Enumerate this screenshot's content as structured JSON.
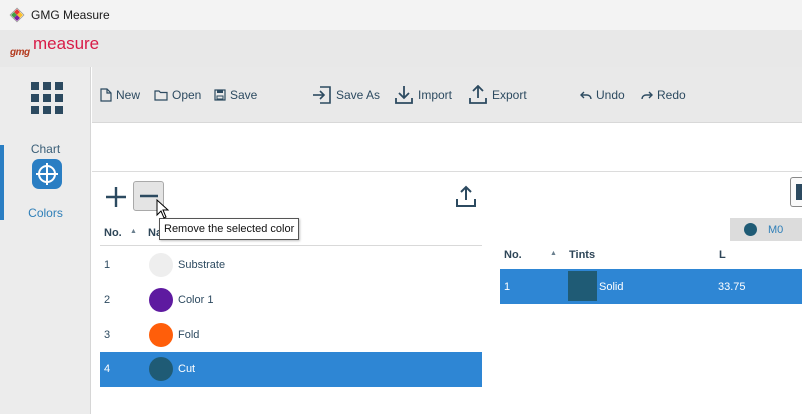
{
  "window": {
    "title": "GMG Measure",
    "icon": "gmg-app-icon"
  },
  "brand": {
    "gmg": "gmg",
    "measure": "measure",
    "color": "#d81b47"
  },
  "nav": [
    {
      "label": "Chart",
      "icon": "grid-icon",
      "selected": false
    },
    {
      "label": "Colors",
      "icon": "color-target-icon",
      "selected": true
    }
  ],
  "toolbar": {
    "new": "New",
    "open": "Open",
    "save": "Save",
    "save_as": "Save As",
    "import": "Import",
    "export": "Export",
    "undo": "Undo",
    "redo": "Redo"
  },
  "colors_list": {
    "headers": {
      "no": "No.",
      "name": "Na"
    },
    "tooltip": "Remove the selected color",
    "rows": [
      {
        "no": "1",
        "name": "Substrate",
        "color": "#eeeeee",
        "selected": false
      },
      {
        "no": "2",
        "name": "Color 1",
        "color": "#5e1aa0",
        "selected": false
      },
      {
        "no": "3",
        "name": "Fold",
        "color": "#ff5e0a",
        "selected": false
      },
      {
        "no": "4",
        "name": "Cut",
        "color": "#1f5b75",
        "selected": true
      }
    ]
  },
  "measurement": {
    "tab": {
      "label": "M0",
      "dot_color": "#1f5b75"
    },
    "headers": {
      "no": "No.",
      "tints": "Tints",
      "l": "L"
    },
    "rows": [
      {
        "no": "1",
        "tint": "Solid",
        "l": "33.75",
        "swatch": "#1f5b75",
        "selected": true
      }
    ]
  },
  "colors": {
    "accent": "#2e86d4",
    "nav_selected": "#2a7ec3",
    "icon": "#2c4a60"
  }
}
